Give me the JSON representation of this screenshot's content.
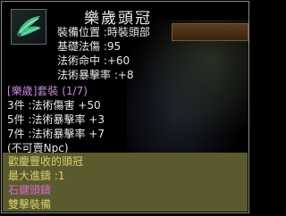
{
  "item": {
    "name": "樂歲頭冠",
    "icon": "green-wing-headpiece-icon"
  },
  "stats": {
    "slot": "裝備位置 :時裝頭部",
    "base_magic": "基礎法傷 :95",
    "magic_hit": "法術命中 :+60",
    "magic_crit": "法術暴擊率 :+8"
  },
  "set": {
    "name_bracket_open": "[",
    "name": "樂歲",
    "name_bracket_close": "]",
    "label": "套裝",
    "count": "(1/7)",
    "bonuses": [
      "3件 :法術傷害 +50",
      "5件 :法術暴擊率 +3",
      "7件 :法術暴擊率 +7"
    ]
  },
  "note": "(不可賣Npc)",
  "description": {
    "line1": "歡慶豐收的頭冠",
    "line2": "最大進鑄 :1",
    "line3": "石鍵頭鑄",
    "line4": "雙擊裝備"
  },
  "colors": {
    "desc_bg": "#5a5a2e",
    "desc_text": "#d8d070",
    "set_color": "#c38ad6"
  }
}
